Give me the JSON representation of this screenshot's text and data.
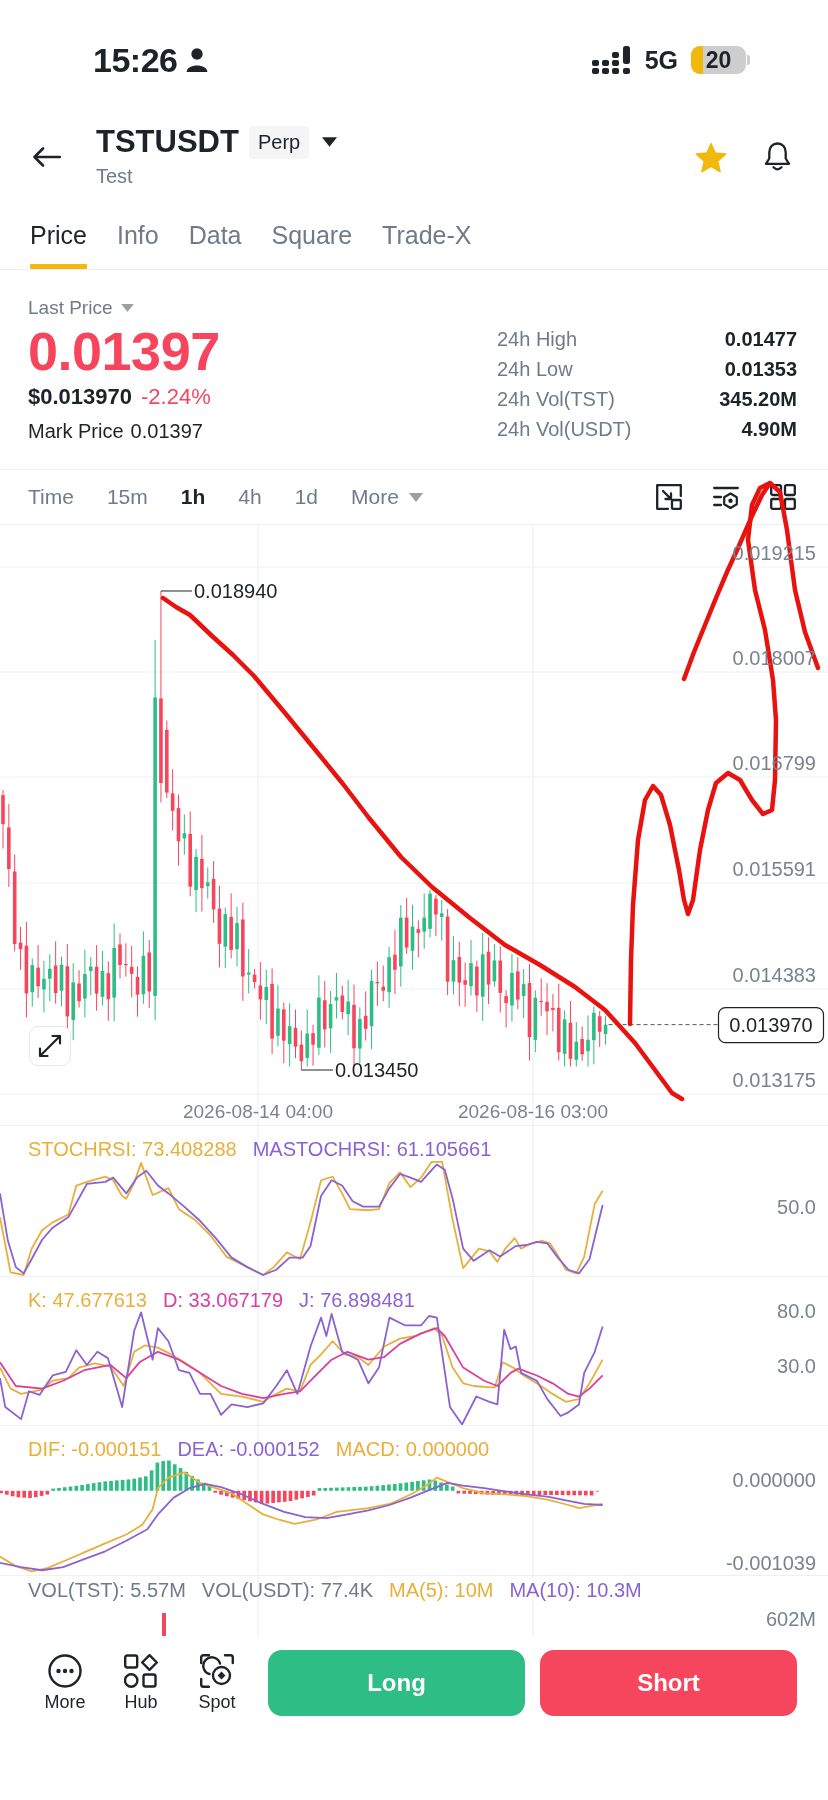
{
  "status_bar": {
    "time": "15:26",
    "network": "5G",
    "battery": "20"
  },
  "header": {
    "symbol": "TSTUSDT",
    "contract_type": "Perp",
    "name": "Test",
    "favorite": true
  },
  "tabs": [
    {
      "label": "Price",
      "selected": true
    },
    {
      "label": "Info",
      "selected": false
    },
    {
      "label": "Data",
      "selected": false
    },
    {
      "label": "Square",
      "selected": false
    },
    {
      "label": "Trade-X",
      "selected": false
    }
  ],
  "price_summary": {
    "label": "Last Price",
    "last_price": "0.01397",
    "usd_price": "$0.013970",
    "change": "-2.24%",
    "mark_price_label": "Mark Price",
    "mark_price": "0.01397",
    "stats": [
      {
        "label": "24h High",
        "value": "0.01477"
      },
      {
        "label": "24h Low",
        "value": "0.01353"
      },
      {
        "label": "24h Vol(TST)",
        "value": "345.20M"
      },
      {
        "label": "24h Vol(USDT)",
        "value": "4.90M"
      }
    ]
  },
  "chart_toolbar": {
    "intervals": [
      {
        "label": "Time",
        "selected": false,
        "kind": "interval"
      },
      {
        "label": "15m",
        "selected": false,
        "kind": "interval"
      },
      {
        "label": "1h",
        "selected": true,
        "kind": "interval"
      },
      {
        "label": "4h",
        "selected": false,
        "kind": "interval"
      },
      {
        "label": "1d",
        "selected": false,
        "kind": "interval"
      },
      {
        "label": "More",
        "selected": false,
        "kind": "menu"
      }
    ]
  },
  "price_chart": {
    "y_axis_labels": [
      "0.019215",
      "0.018007",
      "0.016799",
      "0.015591",
      "0.014383",
      "0.013175"
    ],
    "x_axis_labels": [
      "2026-08-14 04:00",
      "2026-08-16 03:00"
    ],
    "high_marker": "0.018940",
    "low_marker": "0.013450",
    "current_price": "0.013970"
  },
  "indicators": [
    {
      "kind": "stochrsi",
      "legend": [
        {
          "text": "STOCHRSI: 73.408288",
          "color": "#e8b03a"
        },
        {
          "text": "MASTOCHRSI: 61.105661",
          "color": "#8a63d2"
        }
      ],
      "axis_labels": [
        "50.0"
      ]
    },
    {
      "kind": "kdj",
      "legend": [
        {
          "text": "K: 47.677613",
          "color": "#e8b03a"
        },
        {
          "text": "D: 33.067179",
          "color": "#d9409f"
        },
        {
          "text": "J: 76.898481",
          "color": "#8a63d2"
        }
      ],
      "axis_labels": [
        "80.0",
        "30.0"
      ]
    },
    {
      "kind": "macd",
      "legend": [
        {
          "text": "DIF: -0.000151",
          "color": "#e8b03a"
        },
        {
          "text": "DEA: -0.000152",
          "color": "#8a63d2"
        },
        {
          "text": "MACD: 0.000000",
          "color": "#e8b03a"
        }
      ],
      "axis_labels": [
        "0.000000",
        "-0.001039"
      ]
    }
  ],
  "volume": {
    "legend": [
      {
        "text": "VOL(TST): 5.57M",
        "color": "#707a8a"
      },
      {
        "text": "VOL(USDT): 77.4K",
        "color": "#707a8a"
      },
      {
        "text": "MA(5): 10M",
        "color": "#e8b03a"
      },
      {
        "text": "MA(10): 10.3M",
        "color": "#8a63d2"
      }
    ],
    "axis_labels": [
      "602M"
    ]
  },
  "bottom_bar": {
    "shortcuts": [
      {
        "label": "More",
        "kind": "more"
      },
      {
        "label": "Hub",
        "kind": "hub"
      },
      {
        "label": "Spot",
        "kind": "spot"
      }
    ],
    "actions": [
      {
        "label": "Long",
        "kind": "long"
      },
      {
        "label": "Short",
        "kind": "short"
      }
    ]
  }
}
